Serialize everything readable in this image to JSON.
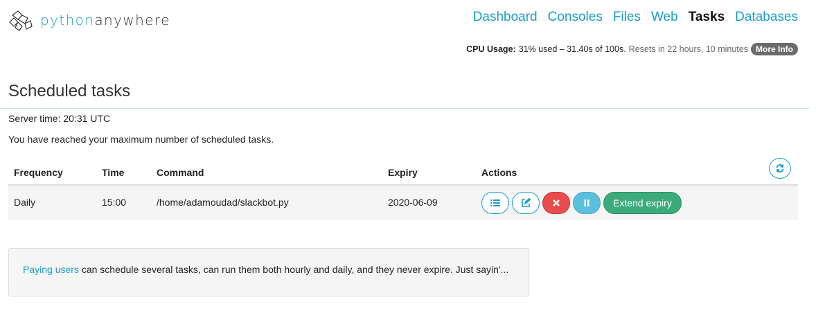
{
  "brand": {
    "prefix": "python",
    "suffix": "anywhere"
  },
  "nav": [
    {
      "label": "Dashboard",
      "active": false
    },
    {
      "label": "Consoles",
      "active": false
    },
    {
      "label": "Files",
      "active": false
    },
    {
      "label": "Web",
      "active": false
    },
    {
      "label": "Tasks",
      "active": true
    },
    {
      "label": "Databases",
      "active": false
    }
  ],
  "cpu": {
    "label": "CPU Usage:",
    "usage": "31% used – 31.40s of 100s.",
    "resets": "Resets in 22 hours, 10 minutes",
    "more_info": "More Info"
  },
  "page": {
    "title": "Scheduled tasks",
    "server_time": "Server time: 20:31 UTC",
    "max_msg": "You have reached your maximum number of scheduled tasks."
  },
  "table": {
    "headers": {
      "frequency": "Frequency",
      "time": "Time",
      "command": "Command",
      "expiry": "Expiry",
      "actions": "Actions"
    },
    "rows": [
      {
        "frequency": "Daily",
        "time": "15:00",
        "command": "/home/adamoudad/slackbot.py",
        "expiry": "2020-06-09"
      }
    ],
    "extend_label": "Extend expiry"
  },
  "promo": {
    "link": "Paying users",
    "text": " can schedule several tasks, can run them both hourly and daily, and they never expire. Just sayin'..."
  },
  "colors": {
    "accent": "#1a9dc8",
    "danger": "#e84c4c",
    "info": "#5bc0de",
    "success": "#3cab7c"
  }
}
